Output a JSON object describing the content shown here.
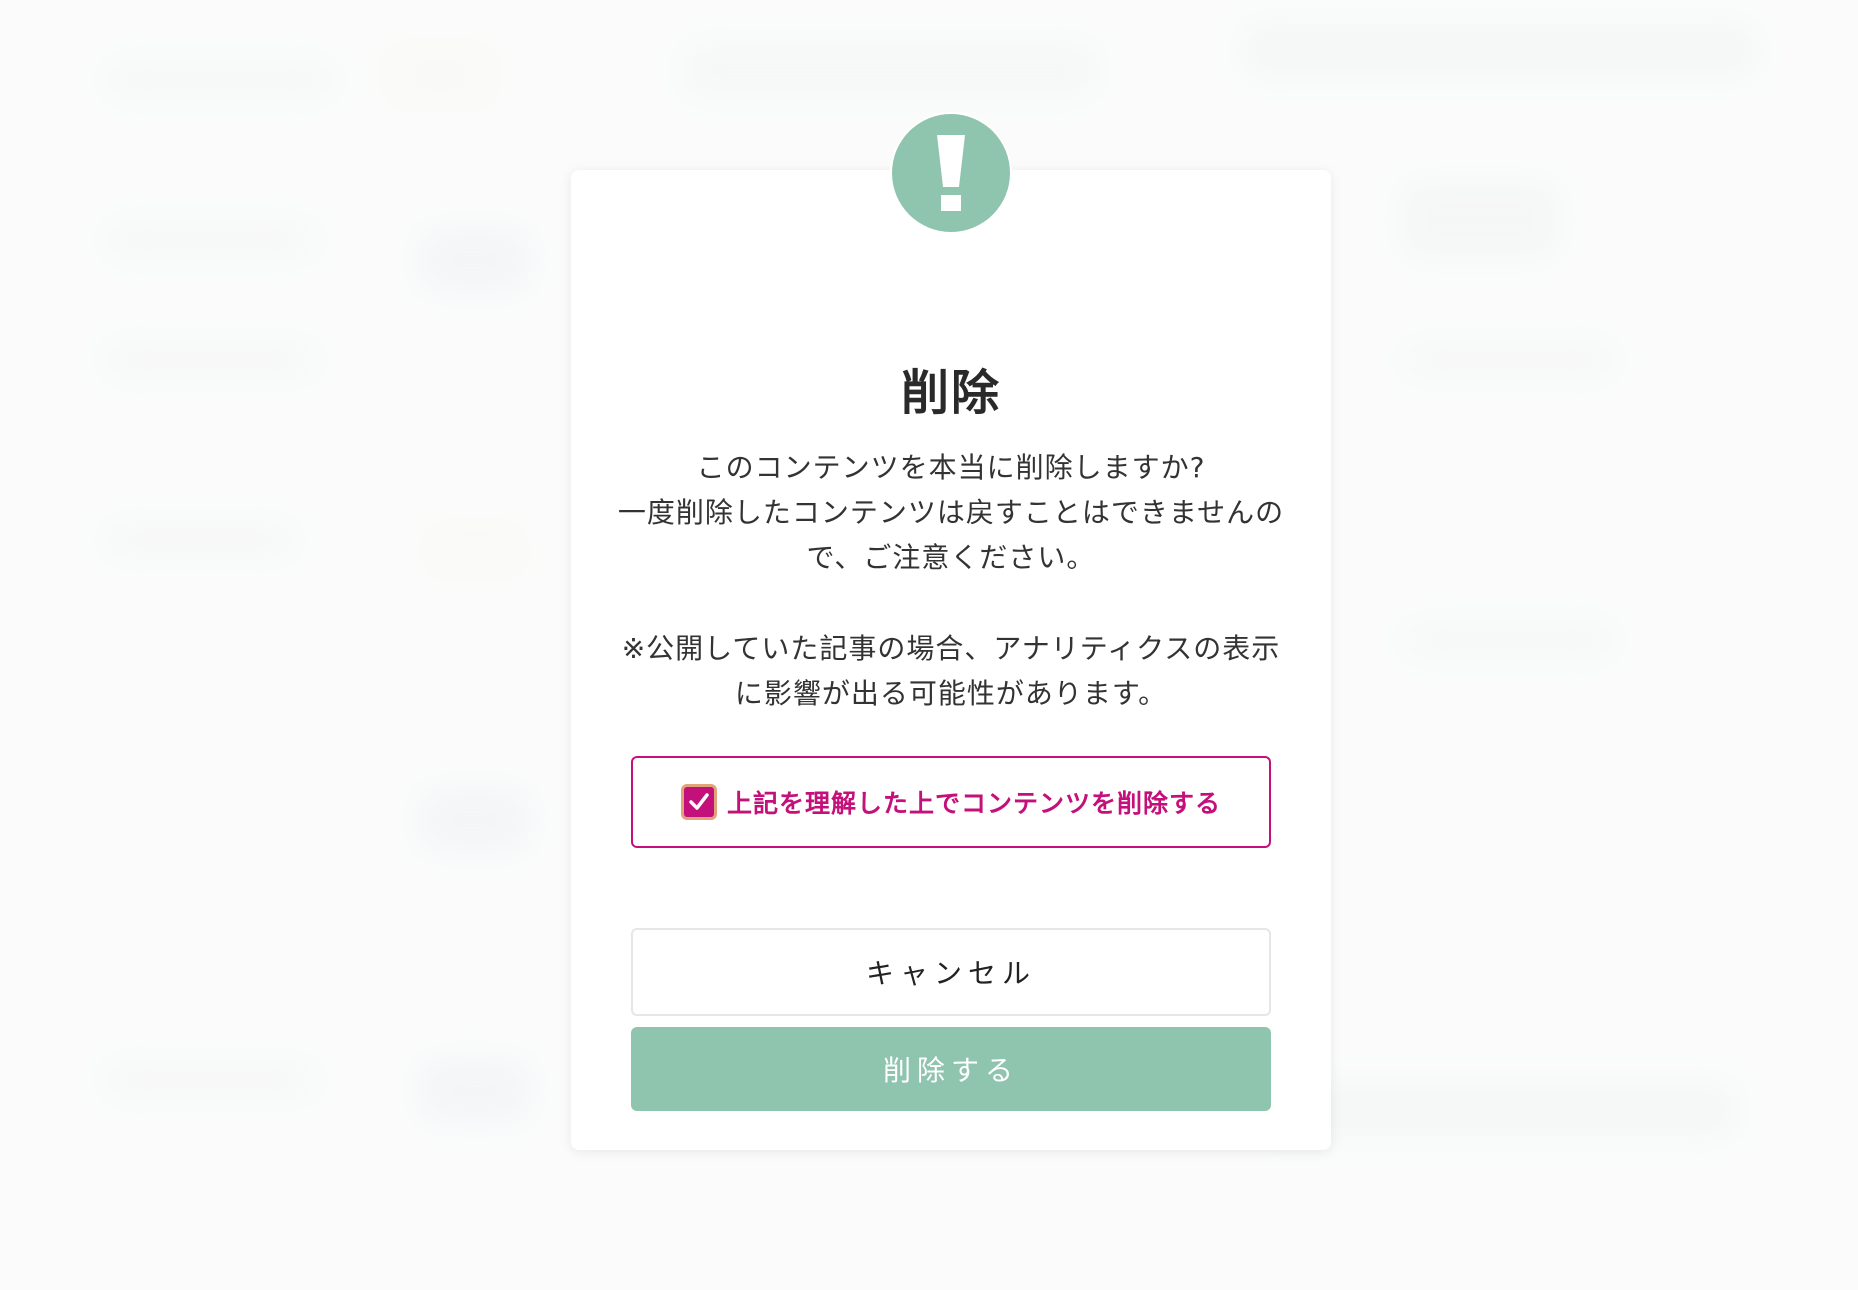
{
  "modal": {
    "title": "削除",
    "message": "このコンテンツを本当に削除しますか?\n一度削除したコンテンツは戻すことはできませんので、ご注意ください。",
    "note": "※公開していた記事の場合、アナリティクスの表示に影響が出る可能性があります。",
    "confirm_label": "上記を理解した上でコンテンツを削除する",
    "confirm_checked": true,
    "cancel_label": "キャンセル",
    "delete_label": "削除する",
    "icon": "exclamation-icon"
  },
  "colors": {
    "accent_green": "#8fc4ae",
    "confirm_magenta": "#c4107a",
    "checkbox_outline": "#e0a37a"
  }
}
